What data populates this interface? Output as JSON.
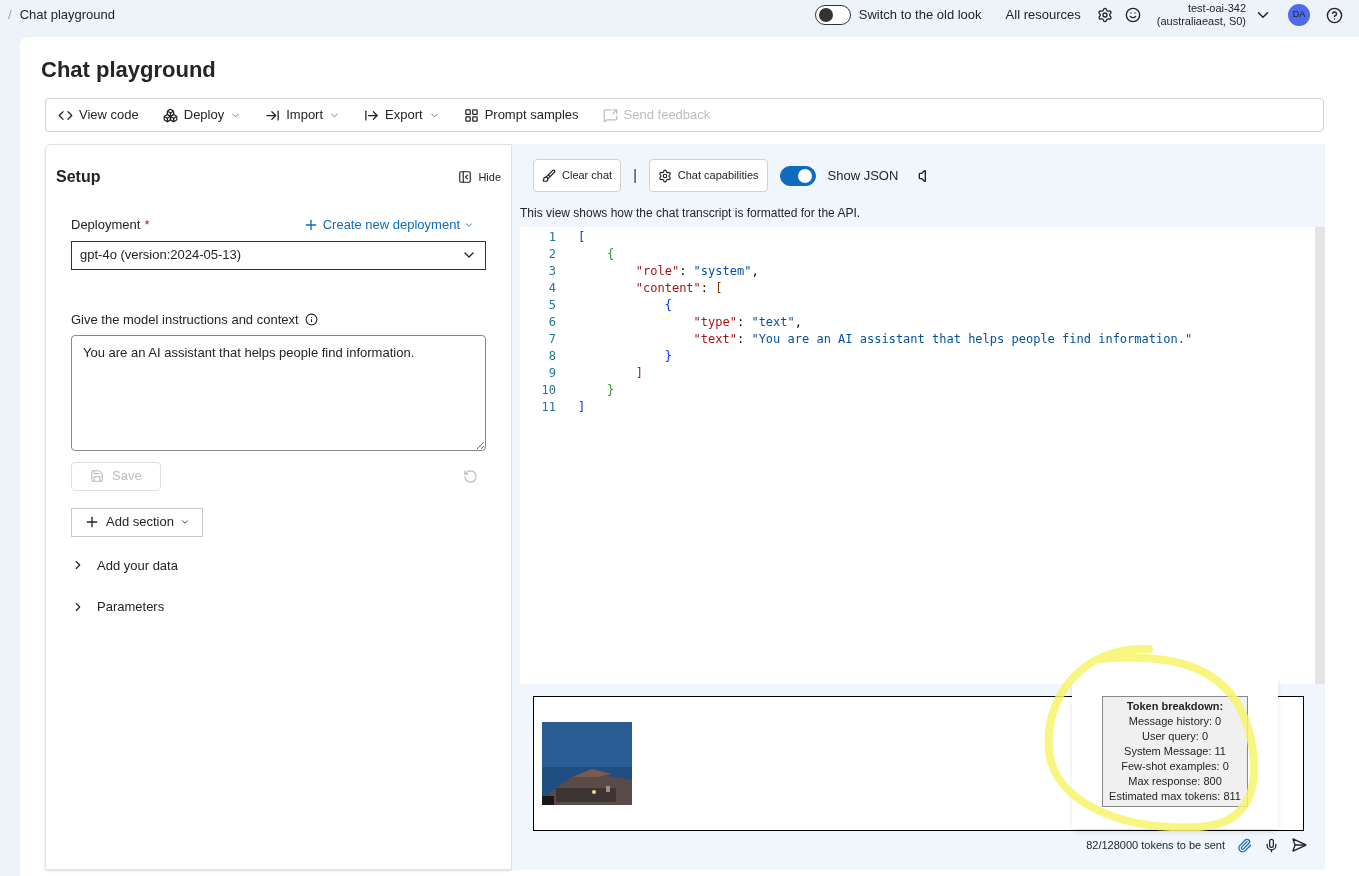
{
  "breadcrumb": {
    "separator": "/",
    "title": "Chat playground"
  },
  "header": {
    "old_look_toggle": {
      "on": false,
      "label": "Switch to the old look"
    },
    "all_resources": "All resources",
    "account": {
      "name": "test-oai-342",
      "region": "(australiaeast, S0)",
      "initials": "DA"
    }
  },
  "page_title": "Chat playground",
  "toolbar": [
    {
      "label": "View code",
      "dropdown": false,
      "disabled": false
    },
    {
      "label": "Deploy",
      "dropdown": true,
      "disabled": false
    },
    {
      "label": "Import",
      "dropdown": true,
      "disabled": false
    },
    {
      "label": "Export",
      "dropdown": true,
      "disabled": false
    },
    {
      "label": "Prompt samples",
      "dropdown": false,
      "disabled": false
    },
    {
      "label": "Send feedback",
      "dropdown": false,
      "disabled": true
    }
  ],
  "setup": {
    "title": "Setup",
    "hide": "Hide",
    "deployment_label": "Deployment",
    "required_mark": "*",
    "create_link": "Create new deployment",
    "deployment_value": "gpt-4o (version:2024-05-13)",
    "instructions_label": "Give the model instructions and context",
    "instructions_value": "You are an AI assistant that helps people find information.",
    "save": {
      "label": "Save",
      "disabled": true
    },
    "add_section": "Add section",
    "sections": [
      {
        "label": "Add your data",
        "expanded": false
      },
      {
        "label": "Parameters",
        "expanded": false
      }
    ]
  },
  "chat": {
    "clear_chat": "Clear chat",
    "divider": "|",
    "capabilities": "Chat capabilities",
    "show_json": {
      "on": true,
      "label": "Show JSON"
    },
    "note": "This view shows how the chat transcript is formatted for the API.",
    "code": [
      [
        {
          "text": "[",
          "color": "#0431fa"
        }
      ],
      [
        {
          "text": "    {",
          "color": "#319331"
        }
      ],
      [
        {
          "text": "        \"role\"",
          "color": "#a31515"
        },
        {
          "text": ": "
        },
        {
          "text": "\"system\"",
          "color": "#0451a5"
        },
        {
          "text": ","
        }
      ],
      [
        {
          "text": "        \"content\"",
          "color": "#a31515"
        },
        {
          "text": ": "
        },
        {
          "text": "[",
          "color": "#7b3814"
        }
      ],
      [
        {
          "text": "            {",
          "color": "#0431fa"
        }
      ],
      [
        {
          "text": "                \"type\"",
          "color": "#a31515"
        },
        {
          "text": ": "
        },
        {
          "text": "\"text\"",
          "color": "#0451a5"
        },
        {
          "text": ","
        }
      ],
      [
        {
          "text": "                \"text\"",
          "color": "#a31515"
        },
        {
          "text": ": "
        },
        {
          "text": "\"You are an AI assistant that helps people find information.\"",
          "color": "#0451a5"
        }
      ],
      [
        {
          "text": "            }",
          "color": "#0431fa"
        }
      ],
      [
        {
          "text": "        ]",
          "color": "#7b3814"
        }
      ],
      [
        {
          "text": "    }",
          "color": "#319331"
        }
      ],
      [
        {
          "text": "]",
          "color": "#0431fa"
        }
      ]
    ],
    "line_numbers": [
      "1",
      "2",
      "3",
      "4",
      "5",
      "6",
      "7",
      "8",
      "9",
      "10",
      "11"
    ],
    "attachment": {
      "kind": "picture"
    },
    "tokens_sent": "82/128000 tokens to be sent",
    "token_breakdown": {
      "title": "Token breakdown:",
      "lines": [
        "Message history: 0",
        "User query: 0",
        "System Message: 11",
        "Few-shot examples: 0",
        "Max response: 800",
        "Estimated max tokens: 811"
      ]
    }
  }
}
